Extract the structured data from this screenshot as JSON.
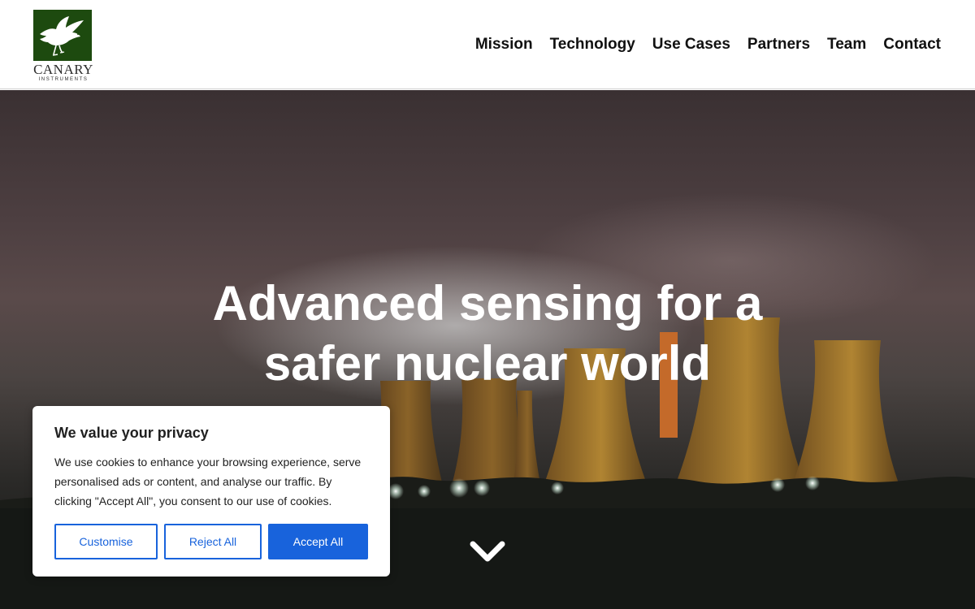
{
  "brand": {
    "name": "CANARY",
    "subtitle": "INSTRUMENTS",
    "colors": {
      "logo_green": "#1d4a0f",
      "accent_blue": "#1863dc"
    }
  },
  "nav": {
    "items": [
      {
        "label": "Mission"
      },
      {
        "label": "Technology"
      },
      {
        "label": "Use Cases"
      },
      {
        "label": "Partners"
      },
      {
        "label": "Team"
      },
      {
        "label": "Contact"
      }
    ]
  },
  "hero": {
    "title": "Advanced sensing for a safer nuclear world",
    "scroll_icon": "chevron-down-icon"
  },
  "cookie_banner": {
    "title": "We value your privacy",
    "text": "We use cookies to enhance your browsing experience, serve personalised ads or content, and analyse our traffic. By clicking \"Accept All\", you consent to our use of cookies.",
    "buttons": {
      "customise": "Customise",
      "reject": "Reject All",
      "accept": "Accept All"
    }
  }
}
